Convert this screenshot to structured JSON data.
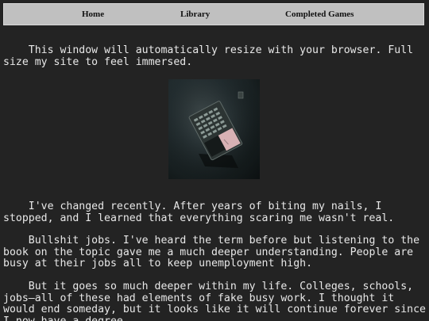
{
  "nav": {
    "items": [
      {
        "label": "Home"
      },
      {
        "label": "Library"
      },
      {
        "label": "Completed Games"
      }
    ]
  },
  "content": {
    "paragraphs": [
      "    This window will automatically resize with your browser. Full size my site to feel immersed.",
      "    I've changed recently. After years of biting my nails, I stopped, and I learned that everything scaring me wasn't real.",
      "    Bullshit jobs. I've heard the term before but listening to the book on the topic gave me a much deeper understanding. People are busy at their jobs all to keep unemployment high.",
      "    But it goes so much deeper within my life. Colleges, schools, jobs—all of these had elements of fake busy work. I thought it would end someday, but it looks like it will continue forever since I now have a degree."
    ]
  },
  "colors": {
    "background": "#232323",
    "navbar": "#c0c0c0",
    "text": "#e8e8e8"
  }
}
